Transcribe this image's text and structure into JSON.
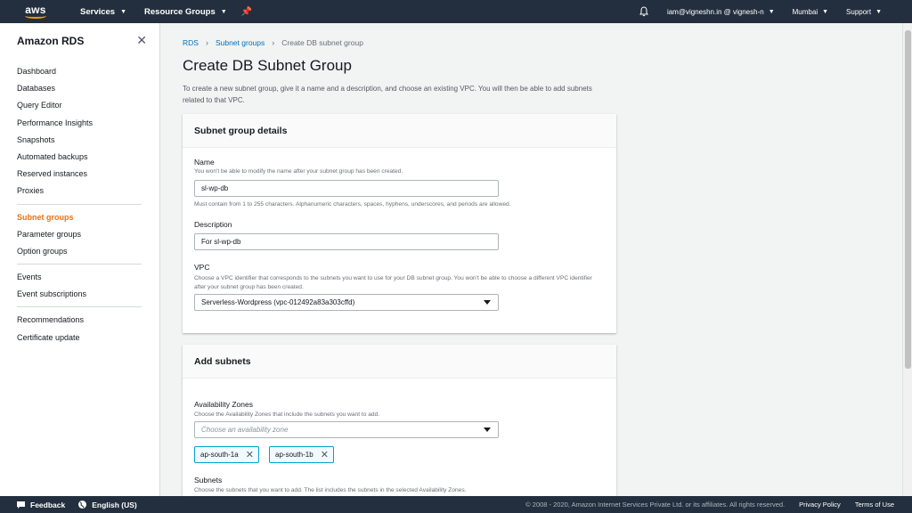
{
  "topnav": {
    "logo_text": "aws",
    "services_label": "Services",
    "resource_groups_label": "Resource Groups",
    "account_label": "iam@vigneshn.in @ vignesh-n",
    "region_label": "Mumbai",
    "support_label": "Support"
  },
  "sidebar": {
    "title": "Amazon RDS",
    "group1": [
      "Dashboard",
      "Databases",
      "Query Editor",
      "Performance Insights",
      "Snapshots",
      "Automated backups",
      "Reserved instances",
      "Proxies"
    ],
    "group2": [
      "Subnet groups",
      "Parameter groups",
      "Option groups"
    ],
    "group3": [
      "Events",
      "Event subscriptions"
    ],
    "group4": [
      "Recommendations",
      "Certificate update"
    ],
    "active": "Subnet groups"
  },
  "breadcrumb": {
    "root": "RDS",
    "parent": "Subnet groups",
    "current": "Create DB subnet group"
  },
  "page": {
    "title": "Create DB Subnet Group",
    "intro": "To create a new subnet group, give it a name and a description, and choose an existing VPC. You will then be able to add subnets related to that VPC."
  },
  "details": {
    "heading": "Subnet group details",
    "name_label": "Name",
    "name_desc": "You won't be able to modify the name after your subnet group has been created.",
    "name_value": "sl-wp-db",
    "name_hint": "Must contain from 1 to 255 characters. Alphanumeric characters, spaces, hyphens, underscores, and periods are allowed.",
    "description_label": "Description",
    "description_value": "For sl-wp-db",
    "vpc_label": "VPC",
    "vpc_desc": "Choose a VPC identifier that corresponds to the subnets you want to use for your DB subnet group. You won't be able to choose a different VPC identifier after your subnet group has been created.",
    "vpc_value": "Serverless-Wordpress (vpc-012492a83a303cffd)"
  },
  "subnets": {
    "heading": "Add subnets",
    "az_label": "Availability Zones",
    "az_desc": "Choose the Availability Zones that include the subnets you want to add.",
    "az_placeholder": "Choose an availability zone",
    "az_tokens": [
      "ap-south-1a",
      "ap-south-1b"
    ],
    "subnets_label": "Subnets",
    "subnets_desc": "Choose the subnets that you want to add. The list includes the subnets in the selected Availability Zones."
  },
  "footer": {
    "feedback": "Feedback",
    "language": "English (US)",
    "copyright": "© 2008 - 2020, Amazon Internet Services Private Ltd. or its affiliates. All rights reserved.",
    "privacy": "Privacy Policy",
    "terms": "Terms of Use"
  },
  "colors": {
    "nav_bg": "#232f3e",
    "accent_orange": "#ec7211",
    "link_blue": "#0073bb",
    "token_border": "#00a1c9"
  }
}
